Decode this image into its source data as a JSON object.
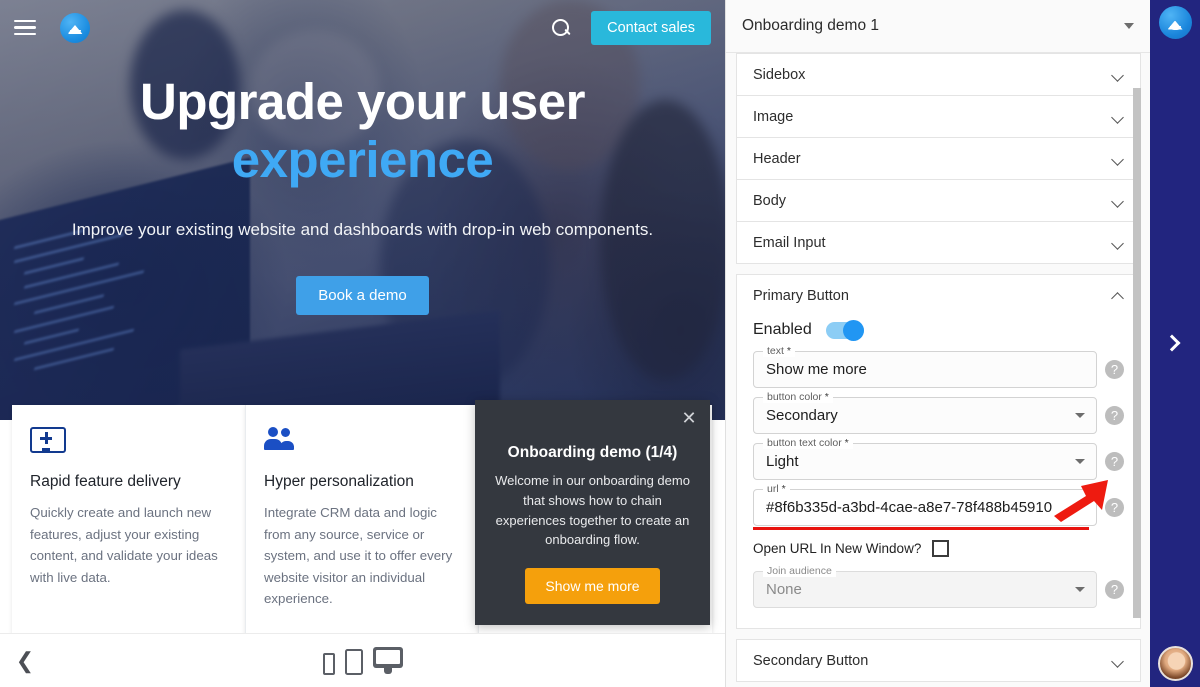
{
  "preview": {
    "nav": {
      "menu_icon": "hamburger-icon",
      "logo_icon": "brand-logo-icon",
      "search_icon": "search-icon",
      "contact_label": "Contact sales"
    },
    "hero": {
      "heading_line1": "Upgrade your user",
      "heading_line2": "experience",
      "subheading": "Improve your existing website and dashboards with drop-in web components.",
      "cta_label": "Book a demo",
      "accent_color": "#3fa9f5"
    },
    "cards": [
      {
        "icon": "screen-plus-icon",
        "title": "Rapid feature delivery",
        "body": "Quickly create and launch new features, adjust your existing content, and validate your ideas with live data.",
        "accent": "#f5b316"
      },
      {
        "icon": "people-icon",
        "title": "Hyper personalization",
        "body": "Integrate CRM data and logic from any source, service or system, and use it to offer every website visitor an individual experience.",
        "accent": "#2aa3e8"
      }
    ],
    "tooltip": {
      "close_icon": "close-icon",
      "title": "Onboarding demo (1/4)",
      "body": "Welcome in our onboarding demo that shows how to chain experiences together to create an onboarding flow.",
      "button_label": "Show me more",
      "button_color": "#f5a00c",
      "background": "#34383f"
    },
    "devicebar": {
      "back_icon": "chevron-left-icon",
      "devices": [
        "phone-icon",
        "tablet-icon",
        "desktop-icon"
      ]
    }
  },
  "panel": {
    "title": "Onboarding demo 1",
    "dropdown_icon": "caret-down-icon",
    "sections": [
      {
        "label": "Sidebox",
        "icon": "chevron-down-icon",
        "expanded": false
      },
      {
        "label": "Image",
        "icon": "chevron-down-icon",
        "expanded": false
      },
      {
        "label": "Header",
        "icon": "chevron-down-icon",
        "expanded": false
      },
      {
        "label": "Body",
        "icon": "chevron-down-icon",
        "expanded": false
      },
      {
        "label": "Email Input",
        "icon": "chevron-down-icon",
        "expanded": false
      }
    ],
    "primary_button": {
      "label": "Primary Button",
      "collapse_icon": "chevron-up-icon",
      "enabled_label": "Enabled",
      "enabled_value": true,
      "toggle_color": "#2196f3",
      "fields": [
        {
          "legend": "text",
          "required": "*",
          "value": "Show me more",
          "type": "text",
          "help": "help-icon"
        },
        {
          "legend": "button color",
          "required": "*",
          "value": "Secondary",
          "type": "select",
          "help": "help-icon"
        },
        {
          "legend": "button text color",
          "required": "*",
          "value": "Light",
          "type": "select",
          "help": "help-icon"
        },
        {
          "legend": "url",
          "required": "*",
          "value": "#8f6b335d-a3bd-4cae-a8e7-78f488b45910",
          "type": "text",
          "help": "help-icon",
          "highlighted": true
        }
      ],
      "checkbox_label": "Open URL In New Window?",
      "checkbox_checked": false,
      "audience_legend": "Join audience",
      "audience_value": "None",
      "audience_help": "help-icon"
    },
    "secondary_button": {
      "label": "Secondary Button",
      "icon": "chevron-down-icon"
    }
  },
  "rail": {
    "logo_icon": "brand-logo-icon",
    "expand_icon": "chevron-right-icon",
    "avatar_icon": "user-avatar",
    "background": "#22257f"
  },
  "annotation": {
    "arrow_color": "#e8130f",
    "underline_color": "#e8130f"
  }
}
